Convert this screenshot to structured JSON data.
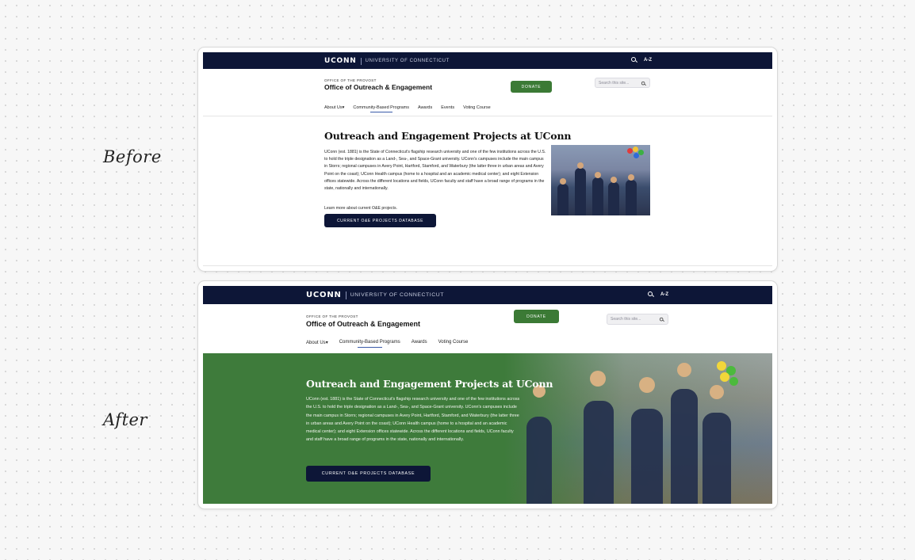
{
  "labels": {
    "before": "Before",
    "after": "After"
  },
  "site": {
    "logo": "UCONN",
    "university": "UNIVERSITY OF CONNECTICUT",
    "az": "A-Z",
    "provost": "OFFICE OF THE PROVOST",
    "office": "Office of Outreach & Engagement",
    "donate": "DONATE",
    "search_placeholder": "Search this site...",
    "icons": [
      "search-icon"
    ]
  },
  "before": {
    "nav": [
      "About Us",
      "Community-Based Programs",
      "Awards",
      "Events",
      "Voting Course"
    ],
    "title": "Outreach and Engagement Projects at UConn",
    "body": "UConn (est. 1881) is the State of Connecticut's flagship research university and one of the few institutions across the U.S. to hold the triple designation as a Land-, Sea-, and Space-Grant university. UConn's campuses include the main campus in Storrs; regional campuses in Avery Point, Hartford, Stamford, and Waterbury (the latter three in urban areas and Avery Point on the coast); UConn Health campus (home to a hospital and an academic medical center); and eight Extension offices statewide. Across the different locations and fields, UConn faculty and staff have a broad range of programs in the state, nationally and internationally.",
    "learn_more": "Learn more about current O&E projects.",
    "button": "CURRENT O&E PROJECTS DATABASE"
  },
  "after": {
    "nav": [
      "About Us",
      "Community-Based Programs",
      "Awards",
      "Voting Course"
    ],
    "title": "Outreach and Engagement Projects at UConn",
    "body": "UConn (est. 1881) is the State of Connecticut's flagship research university and one of the few institutions across the U.S. to hold the triple designation as a Land-, Sea-, and Space-Grant university. UConn's campuses include the main campus in Storrs; regional campuses in Avery Point, Hartford, Stamford, and Waterbury (the latter three in urban areas and Avery Point on the coast); UConn Health campus (home to a hospital and an academic medical center); and eight Extension offices statewide. Across the different locations and fields, UConn faculty and staff have a broad range of programs in the state, nationally and internationally.",
    "button": "CURRENT O&E PROJECTS DATABASE"
  },
  "colors": {
    "navy": "#0d1637",
    "green": "#3b7a35",
    "hero_green": "#3e7b3b"
  }
}
